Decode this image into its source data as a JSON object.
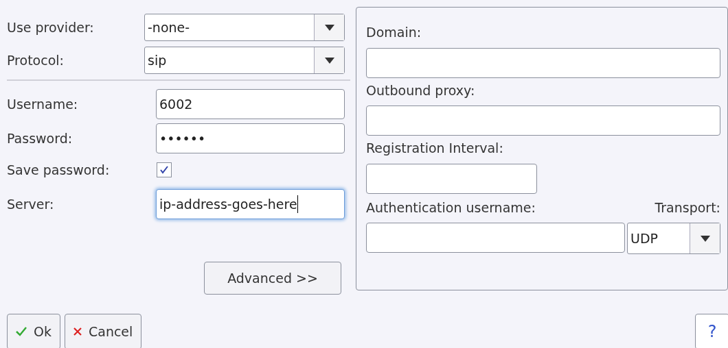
{
  "left_rows": [
    {
      "kind": "select",
      "label": "Use provider:",
      "value": "-none-"
    },
    {
      "kind": "select",
      "label": "Protocol:",
      "value": "sip"
    },
    {
      "kind": "divider"
    },
    {
      "kind": "text",
      "label": "Username:",
      "value": "6002",
      "focused": false
    },
    {
      "kind": "text",
      "label": "Password:",
      "value": "••••••",
      "focused": false
    },
    {
      "kind": "checkbox",
      "label": "Save password:",
      "checked": true
    },
    {
      "kind": "text",
      "label": "Server:",
      "value": "ip-address-goes-here",
      "focused": true
    }
  ],
  "advanced_button": "Advanced >>",
  "right_panel": {
    "domain": {
      "label": "Domain:"
    },
    "outbound_proxy": {
      "label": "Outbound proxy:"
    },
    "registration_interval": {
      "label": "Registration Interval:"
    },
    "authentication_username": {
      "label": "Authentication username:"
    },
    "transport": {
      "label": "Transport:",
      "value": "UDP"
    }
  },
  "buttons": [
    {
      "kind": "ok",
      "label": "Ok"
    },
    {
      "kind": "cancel",
      "label": "Cancel"
    },
    {
      "kind": "help",
      "label": "?"
    }
  ]
}
